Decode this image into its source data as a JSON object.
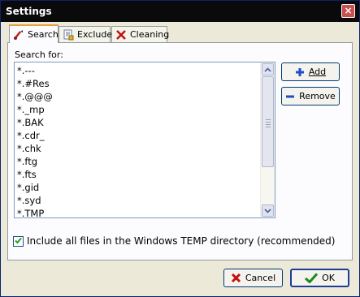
{
  "window": {
    "title": "Settings",
    "close_glyph": "×"
  },
  "tabs": [
    {
      "label": "Search",
      "icon": "search-icon",
      "active": true
    },
    {
      "label": "Exclude",
      "icon": "exclude-icon",
      "active": false
    },
    {
      "label": "Cleaning",
      "icon": "cleaning-x-icon",
      "active": false
    }
  ],
  "search": {
    "label": "Search for:",
    "items": [
      "*.---",
      "*.#Res",
      "*.@@@",
      "*._mp",
      "*.BAK",
      "*.cdr_",
      "*.chk",
      "*.ftg",
      "*.fts",
      "*.gid",
      "*.syd",
      "*.TMP"
    ]
  },
  "buttons": {
    "add": "Add",
    "remove": "Remove",
    "cancel": "Cancel",
    "ok": "OK"
  },
  "option": {
    "label": "Include all files in the Windows TEMP directory (recommended)",
    "checked": true
  },
  "colors": {
    "add_icon": "#1d4ec5",
    "remove_icon": "#1d4ec5",
    "cancel_icon": "#c01010",
    "ok_icon": "#1b8a1b"
  }
}
